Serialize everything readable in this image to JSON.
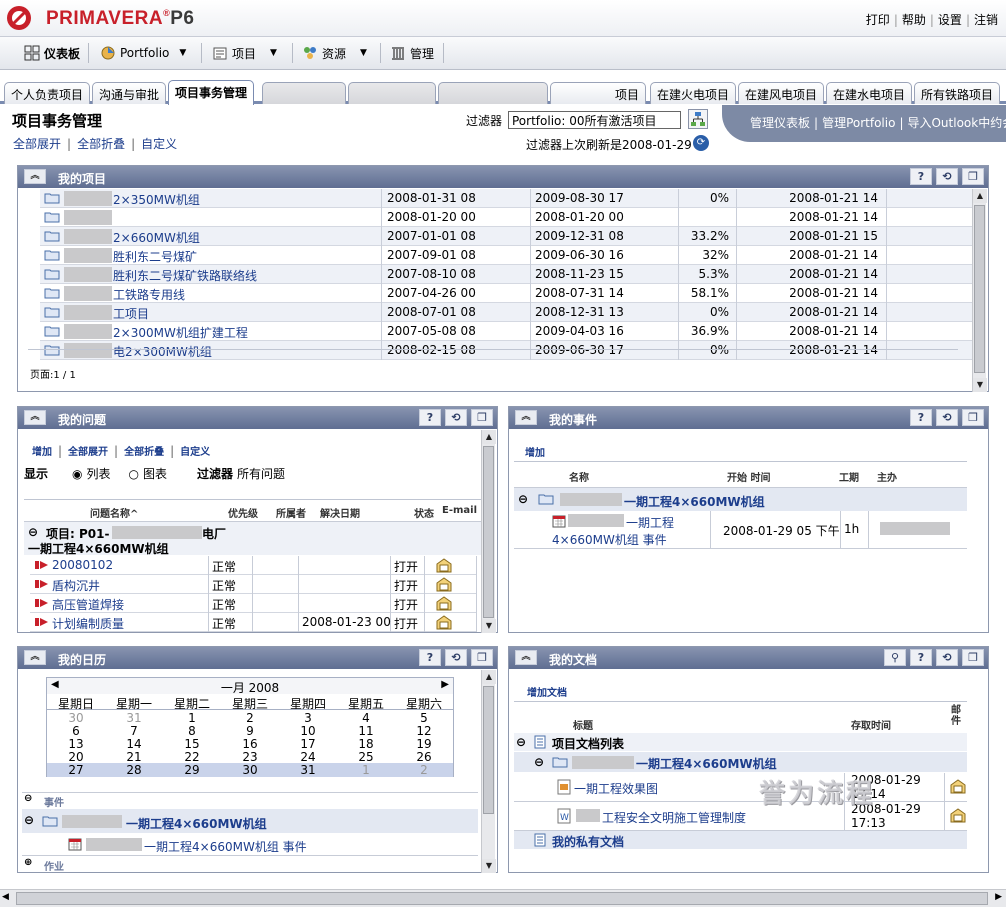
{
  "header": {
    "brand": "PRIMAVERA",
    "brand_mark": "®",
    "brand_suffix": "P6",
    "links": [
      "打印",
      "帮助",
      "设置",
      "注销"
    ]
  },
  "toolbar": {
    "dashboard": "仪表板",
    "portfolio": "Portfolio",
    "projects": "项目",
    "resources": "资源",
    "admin": "管理"
  },
  "tabs": [
    {
      "label": "个人负责项目"
    },
    {
      "label": "沟通与审批"
    },
    {
      "label": "项目事务管理",
      "active": true
    },
    {
      "label": "项目"
    },
    {
      "label": "在建火电项目"
    },
    {
      "label": "在建风电项目"
    },
    {
      "label": "在建水电项目"
    },
    {
      "label": "所有铁路项目"
    }
  ],
  "page": {
    "title": "项目事务管理",
    "expand_all": "全部展开",
    "collapse_all": "全部折叠",
    "customize": "自定义",
    "filter_label": "过滤器",
    "filter_value": "Portfolio: 00所有激活项目",
    "refresh_text": "过滤器上次刷新是2008-01-29",
    "banner_links": [
      "管理仪表板",
      "管理Portfolio",
      "导入Outlook中约会"
    ]
  },
  "projects": {
    "title": "我的项目",
    "rows": [
      {
        "name": "2×350MW机组",
        "start": "2008-01-31 08",
        "finish": "2009-08-30 17",
        "pct": "0%",
        "updated": "2008-01-21 14"
      },
      {
        "name": "",
        "start": "2008-01-20 00",
        "finish": "2008-01-20 00",
        "pct": "",
        "updated": "2008-01-21 14"
      },
      {
        "name": "2×660MW机组",
        "start": "2007-01-01 08",
        "finish": "2009-12-31 08",
        "pct": "33.2%",
        "updated": "2008-01-21 15"
      },
      {
        "name": "胜利东二号煤矿",
        "start": "2007-09-01 08",
        "finish": "2009-06-30 16",
        "pct": "32%",
        "updated": "2008-01-21 14"
      },
      {
        "name": "胜利东二号煤矿铁路联络线",
        "start": "2007-08-10 08",
        "finish": "2008-11-23 15",
        "pct": "5.3%",
        "updated": "2008-01-21 14"
      },
      {
        "name": "工铁路专用线",
        "start": "2007-04-26 00",
        "finish": "2008-07-31 14",
        "pct": "58.1%",
        "updated": "2008-01-21 14"
      },
      {
        "name": "工项目",
        "start": "2008-07-01 08",
        "finish": "2008-12-31 13",
        "pct": "0%",
        "updated": "2008-01-21 14"
      },
      {
        "name": "2×300MW机组扩建工程",
        "start": "2007-05-08 08",
        "finish": "2009-04-03 16",
        "pct": "36.9%",
        "updated": "2008-01-21 14"
      },
      {
        "name": "电2×300MW机组",
        "start": "2008-02-15 08",
        "finish": "2009-06-30 17",
        "pct": "0%",
        "updated": "2008-01-21 14"
      }
    ],
    "pager": "页面:1 / 1"
  },
  "issues": {
    "title": "我的问题",
    "add": "增加",
    "expand_all": "全部展开",
    "collapse_all": "全部折叠",
    "customize": "自定义",
    "show_label": "显示",
    "list_option": "列表",
    "chart_option": "图表",
    "filter_label": "过滤器",
    "filter_value": "所有问题",
    "columns": [
      "问题名称^",
      "优先级",
      "所属者",
      "解决日期",
      "状态",
      "E-mail"
    ],
    "group_label_1": "项目: P01-",
    "group_label_2": "电厂",
    "group_label_3": "一期工程4×660MW机组",
    "rows": [
      {
        "name": "20080102",
        "priority": "正常",
        "date": "",
        "status": "打开"
      },
      {
        "name": "盾构沉井",
        "priority": "正常",
        "date": "",
        "status": "打开"
      },
      {
        "name": "高压管道焊接",
        "priority": "正常",
        "date": "",
        "status": "打开"
      },
      {
        "name": "计划编制质量",
        "priority": "正常",
        "date": "2008-01-23 00",
        "status": "打开"
      }
    ]
  },
  "events": {
    "title": "我的事件",
    "add": "增加",
    "columns": [
      "名称",
      "开始 时间",
      "工期",
      "主办"
    ],
    "group": "一期工程4×660MW机组",
    "row_name_1": "一期工程",
    "row_name_2": "4×660MW机组 事件",
    "row_start": "2008-01-29 05 下午",
    "row_duration": "1h"
  },
  "calendar": {
    "title": "我的日历",
    "month": "一月 2008",
    "weekdays": [
      "星期日",
      "星期一",
      "星期二",
      "星期三",
      "星期四",
      "星期五",
      "星期六"
    ],
    "weeks": [
      [
        "30",
        "31",
        "1",
        "2",
        "3",
        "4",
        "5"
      ],
      [
        "6",
        "7",
        "8",
        "9",
        "10",
        "11",
        "12"
      ],
      [
        "13",
        "14",
        "15",
        "16",
        "17",
        "18",
        "19"
      ],
      [
        "20",
        "21",
        "22",
        "23",
        "24",
        "25",
        "26"
      ],
      [
        "27",
        "28",
        "29",
        "30",
        "31",
        "1",
        "2"
      ]
    ],
    "events_label": "事件",
    "group": "一期工程4×660MW机组",
    "event": "一期工程4×660MW机组 事件",
    "work_label": "作业"
  },
  "documents": {
    "title": "我的文档",
    "add": "增加文档",
    "columns": [
      "标题",
      "存取时间",
      "邮件"
    ],
    "root": "项目文档列表",
    "group": "一期工程4×660MW机组",
    "rows": [
      {
        "name": "一期工程效果图",
        "date": "2008-01-29",
        "time": "17:14"
      },
      {
        "name": "工程安全文明施工管理制度",
        "date": "2008-01-29",
        "time": "17:13"
      }
    ],
    "private": "我的私有文档",
    "watermark": "誉为流程"
  },
  "colors": {
    "accent_red": "#c8202a",
    "portlet_header": "#6c7a9c",
    "link": "#1c3d8c"
  }
}
